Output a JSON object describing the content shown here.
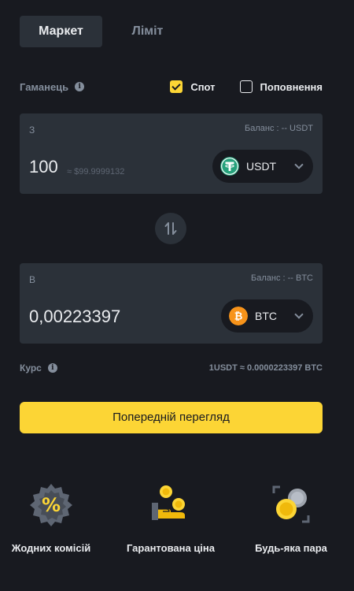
{
  "tabs": [
    {
      "label": "Маркет",
      "active": true
    },
    {
      "label": "Ліміт",
      "active": false
    }
  ],
  "wallet": {
    "label": "Гаманець",
    "options": [
      {
        "label": "Спот",
        "checked": true
      },
      {
        "label": "Поповнення",
        "checked": false
      }
    ]
  },
  "from": {
    "label": "З",
    "balance": "Баланс : -- USDT",
    "amount": "100",
    "usd_value": "≈ $99.9999132",
    "coin": "USDT",
    "coin_icon": "tether-icon",
    "coin_color": "#26a17b"
  },
  "to": {
    "label": "В",
    "balance": "Баланс : -- BTC",
    "amount": "0,00223397",
    "coin": "BTC",
    "coin_icon": "bitcoin-icon",
    "coin_color": "#f7931a"
  },
  "rate": {
    "label": "Курс",
    "value": "1USDT ≈ 0.0000223397 BTC"
  },
  "preview_button": "Попередній перегляд",
  "features": [
    {
      "label": "Жодних комісій",
      "icon": "zero-fee-badge-icon"
    },
    {
      "label": "Гарантована ціна",
      "icon": "guaranteed-price-icon"
    },
    {
      "label": "Будь-яка пара",
      "icon": "any-pair-icon"
    }
  ],
  "colors": {
    "background": "#181a20",
    "card": "#2b3139",
    "accent": "#fcd535",
    "muted": "#848e9c"
  }
}
